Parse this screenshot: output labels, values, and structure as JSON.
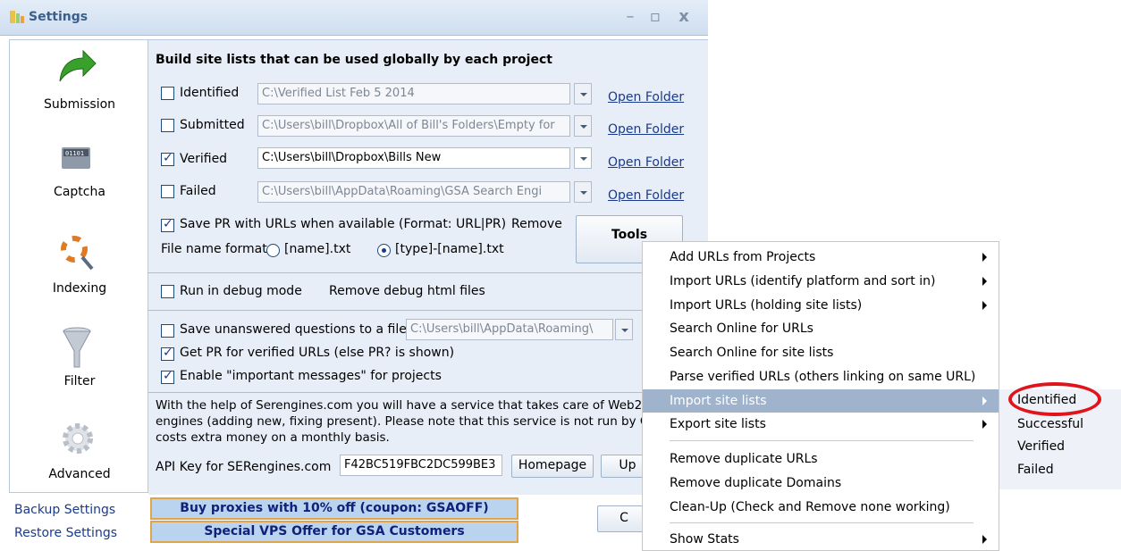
{
  "window": {
    "title": "Settings"
  },
  "sidebar": {
    "items": [
      {
        "label": "Submission",
        "icon": "green-arrow-icon"
      },
      {
        "label": "Captcha",
        "icon": "binary-disk-icon"
      },
      {
        "label": "Indexing",
        "icon": "lifebuoy-magnifier-icon"
      },
      {
        "label": "Filter",
        "icon": "funnel-icon"
      },
      {
        "label": "Advanced",
        "icon": "gear-icon"
      }
    ],
    "links": [
      "Backup Settings",
      "Restore Settings"
    ]
  },
  "site_lists": {
    "heading": "Build site lists that can be used globally by each project",
    "rows": [
      {
        "label": "Identified",
        "checked": false,
        "path": "C:\\Verified List Feb 5 2014",
        "link": "Open Folder"
      },
      {
        "label": "Submitted",
        "checked": false,
        "path": "C:\\Users\\bill\\Dropbox\\All of Bill's Folders\\Empty for",
        "link": "Open Folder"
      },
      {
        "label": "Verified",
        "checked": true,
        "path": "C:\\Users\\bill\\Dropbox\\Bills New",
        "link": "Open Folder"
      },
      {
        "label": "Failed",
        "checked": false,
        "path": "C:\\Users\\bill\\AppData\\Roaming\\GSA Search Engi",
        "link": "Open Folder"
      }
    ],
    "save_pr": "Save PR with URLs when available (Format: URL|PR)",
    "remove": "Remove",
    "file_name_format": "File name format:",
    "format_opt1": "[name].txt",
    "format_opt2": "[type]-[name].txt",
    "tools": "Tools"
  },
  "debug": {
    "run_debug": "Run in debug mode",
    "remove_debug": "Remove debug html files"
  },
  "options": {
    "save_unanswered": "Save unanswered questions to a file",
    "unanswered_path": "C:\\Users\\bill\\AppData\\Roaming\\",
    "get_pr": "Get PR for verified URLs (else PR? is shown)",
    "enable_msgs": "Enable \"important messages\" for projects"
  },
  "serengines": {
    "line1": "With the help of Serengines.com you will have a service that takes care of Web2.",
    "line2": "engines (adding new, fixing present). Please note that this service is not run by GS",
    "line3": "costs extra money on a monthly basis.",
    "api_label": "API Key for SERengines.com",
    "api_value": "F42BC519FBC2DC599BE3",
    "homepage": "Homepage",
    "update": "Up"
  },
  "promo": {
    "proxies": "Buy proxies with 10% off  (coupon: GSAOFF)",
    "vps": "Special VPS Offer for GSA Customers"
  },
  "ok_button": "C",
  "menu": {
    "items": [
      {
        "label": "Add URLs from Projects",
        "submenu": true
      },
      {
        "label": "Import URLs (identify platform and sort in)",
        "submenu": true
      },
      {
        "label": "Import URLs (holding site lists)",
        "submenu": true
      },
      {
        "label": "Search Online for URLs",
        "submenu": false
      },
      {
        "label": "Search Online for site lists",
        "submenu": false
      },
      {
        "label": "Parse verified URLs (others linking on same URL)",
        "submenu": false
      },
      {
        "label": "Import site lists",
        "submenu": true,
        "highlighted": true
      },
      {
        "label": "Export site lists",
        "submenu": true
      },
      {
        "label": "Remove duplicate URLs",
        "submenu": false
      },
      {
        "label": "Remove duplicate Domains",
        "submenu": false
      },
      {
        "label": "Clean-Up (Check and Remove none working)",
        "submenu": false
      },
      {
        "label": "Show Stats",
        "submenu": true
      }
    ],
    "submenu_items": [
      "Identified",
      "Successful",
      "Verified",
      "Failed"
    ]
  },
  "colors": {
    "accent": "#9fb3cc",
    "highlight_ring": "#e0141a",
    "link": "#1a3a8c"
  }
}
